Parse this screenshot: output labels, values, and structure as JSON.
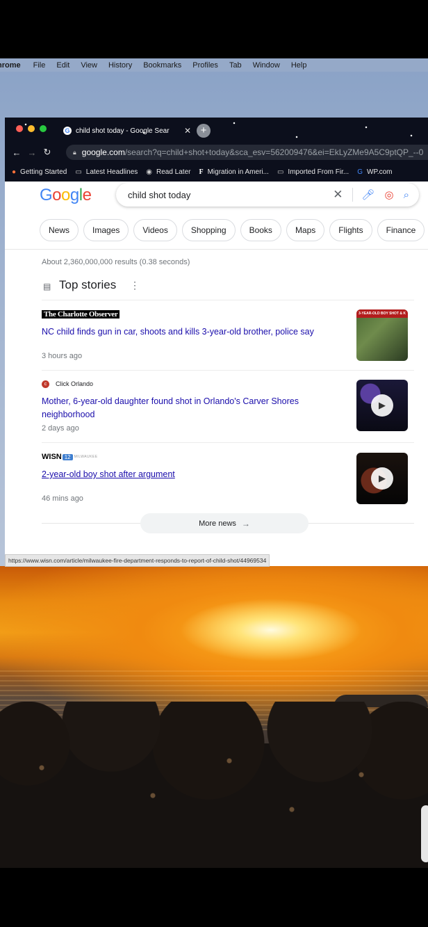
{
  "menubar": {
    "app": "nrome",
    "items": [
      "File",
      "Edit",
      "View",
      "History",
      "Bookmarks",
      "Profiles",
      "Tab",
      "Window",
      "Help"
    ]
  },
  "browser": {
    "tab_title": "child shot today - Google Sear",
    "new_tab": "+",
    "url_host": "google.com",
    "url_rest": "/search?q=child+shot+today&sca_esv=562009476&ei=EkLyZMe9A5C9ptQP_--0",
    "bookmarks": [
      {
        "icon": "firefox-icon",
        "label": "Getting Started"
      },
      {
        "icon": "folder-icon",
        "label": "Latest Headlines"
      },
      {
        "icon": "read-later-icon",
        "label": "Read Later"
      },
      {
        "icon": "f-icon",
        "label": "Migration in Ameri..."
      },
      {
        "icon": "folder-icon",
        "label": "Imported From Fir..."
      },
      {
        "icon": "wp-icon",
        "label": "WP.com"
      }
    ],
    "status_url": "https://www.wisn.com/article/milwaukee-fire-department-responds-to-report-of-child-shot/44969534"
  },
  "search": {
    "logo": "Google",
    "query": "child shot today",
    "chips": [
      "News",
      "Images",
      "Videos",
      "Shopping",
      "Books",
      "Maps",
      "Flights",
      "Finance"
    ],
    "result_stats": "About 2,360,000,000 results (0.38 seconds)"
  },
  "top_stories": {
    "title": "Top stories",
    "more_news": "More news",
    "stories": [
      {
        "source": "The Charlotte Observer",
        "headline": "NC child finds gun in car, shoots and kills 3-year-old brother, police say",
        "time": "3 hours ago",
        "thumb_text": "3-YEAR-OLD BOY SHOT & K"
      },
      {
        "source": "Click Orlando",
        "headline": "Mother, 6-year-old daughter found shot in Orlando's Carver Shores neighborhood",
        "time": "2 days ago"
      },
      {
        "source_main": "WISN",
        "source_badge": "12",
        "source_sub": "MILWAUKEE",
        "headline": "2-year-old boy shot after argument",
        "time": "46 mins ago"
      }
    ]
  },
  "colors": {
    "link": "#1a0dab",
    "tab_bg": "#0c0f1c",
    "muted": "#70757a"
  }
}
